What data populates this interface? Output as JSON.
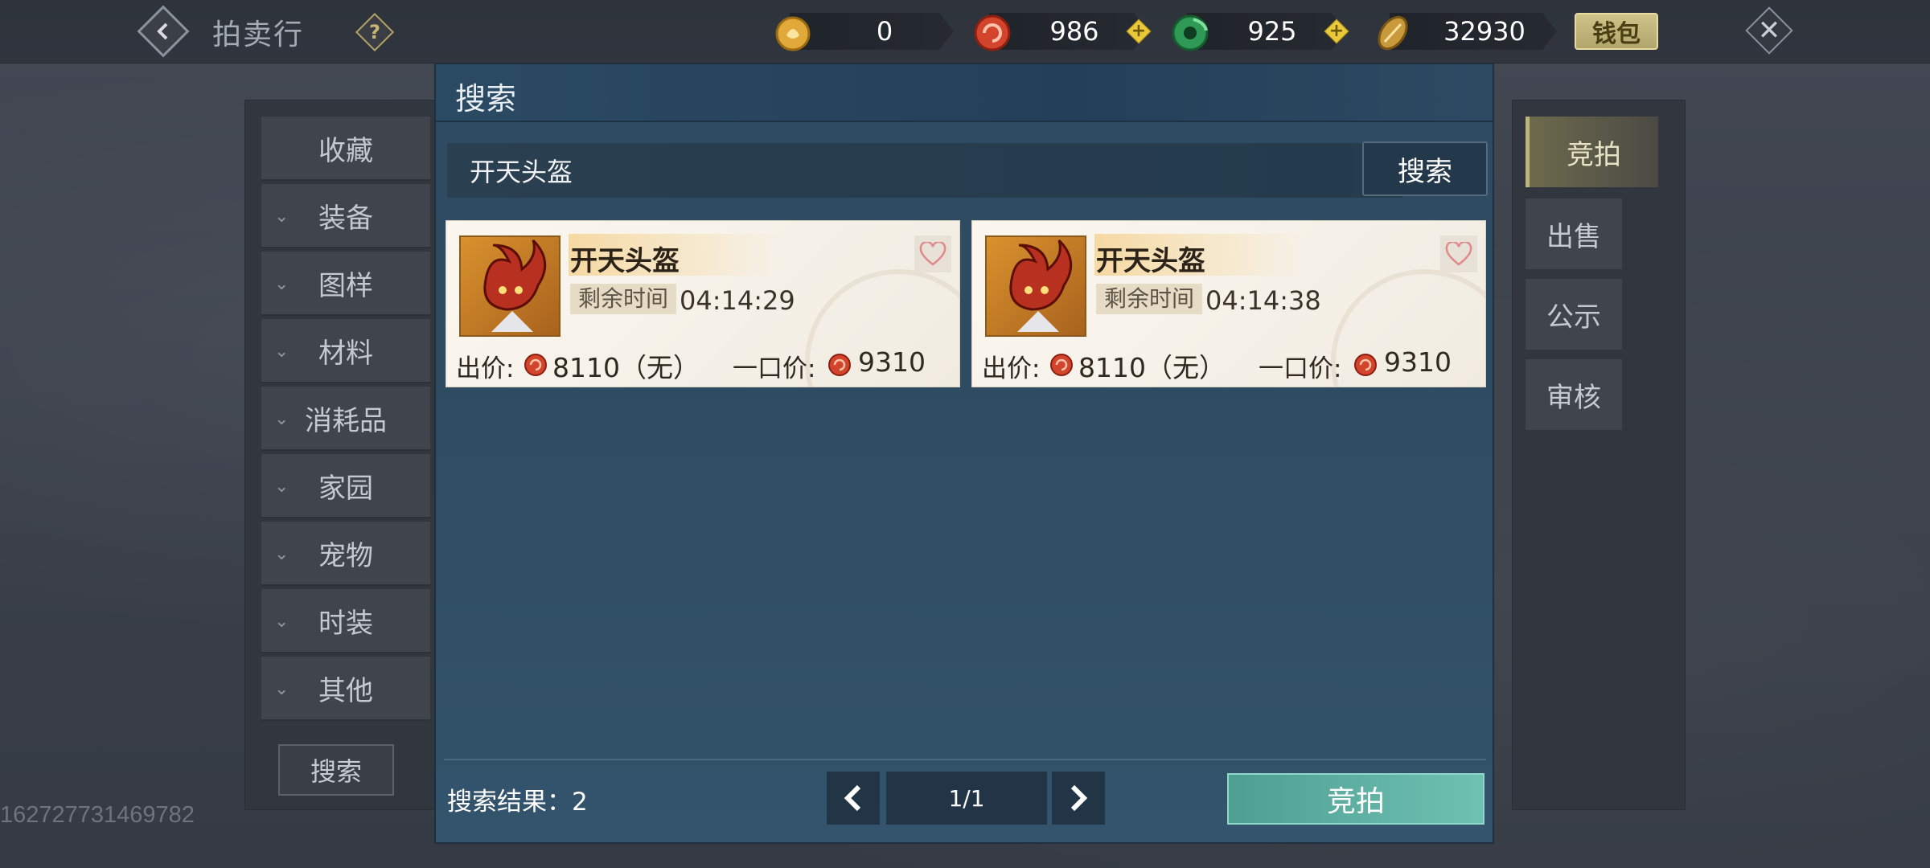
{
  "topbar": {
    "title": "拍卖行",
    "help_icon": "question-icon",
    "currencies": [
      {
        "name": "coin-gold",
        "value": "0",
        "plus": false
      },
      {
        "name": "coin-red",
        "value": "986",
        "plus": true
      },
      {
        "name": "coin-jade",
        "value": "925",
        "plus": true
      },
      {
        "name": "coin-silver",
        "value": "32930",
        "plus": false
      }
    ],
    "wallet_label": "钱包",
    "close_glyph": "✕"
  },
  "left_panel": {
    "items": [
      {
        "label": "收藏",
        "chevron": false
      },
      {
        "label": "装备",
        "chevron": true
      },
      {
        "label": "图样",
        "chevron": true
      },
      {
        "label": "材料",
        "chevron": true
      },
      {
        "label": "消耗品",
        "chevron": true
      },
      {
        "label": "家园",
        "chevron": true
      },
      {
        "label": "宠物",
        "chevron": true
      },
      {
        "label": "时装",
        "chevron": true
      },
      {
        "label": "其他",
        "chevron": true
      }
    ],
    "search_label": "搜索"
  },
  "user_id": "162727731469782",
  "right_panel": {
    "tabs": [
      {
        "label": "竞拍",
        "active": true
      },
      {
        "label": "出售",
        "active": false
      },
      {
        "label": "公示",
        "active": false
      },
      {
        "label": "审核",
        "active": false
      }
    ]
  },
  "modal": {
    "title": "搜索",
    "search_value": "开天头盔",
    "search_button": "搜索",
    "results": [
      {
        "name": "开天头盔",
        "remain_label": "剩余时间",
        "remain_time": "04:14:29",
        "bid_label": "出价:",
        "bid_value": "8110（无）",
        "buyout_label": "一口价:",
        "buyout_value": "9310"
      },
      {
        "name": "开天头盔",
        "remain_label": "剩余时间",
        "remain_time": "04:14:38",
        "bid_label": "出价:",
        "bid_value": "8110（无）",
        "buyout_label": "一口价:",
        "buyout_value": "9310"
      }
    ],
    "result_count_label": "搜索结果：2",
    "page_indicator": "1/1",
    "bid_button": "竞拍"
  },
  "colors": {
    "accent_teal": "#6fc1b2",
    "wallet_gold": "#cfc38a",
    "modal_bg": "#2f4b63"
  }
}
